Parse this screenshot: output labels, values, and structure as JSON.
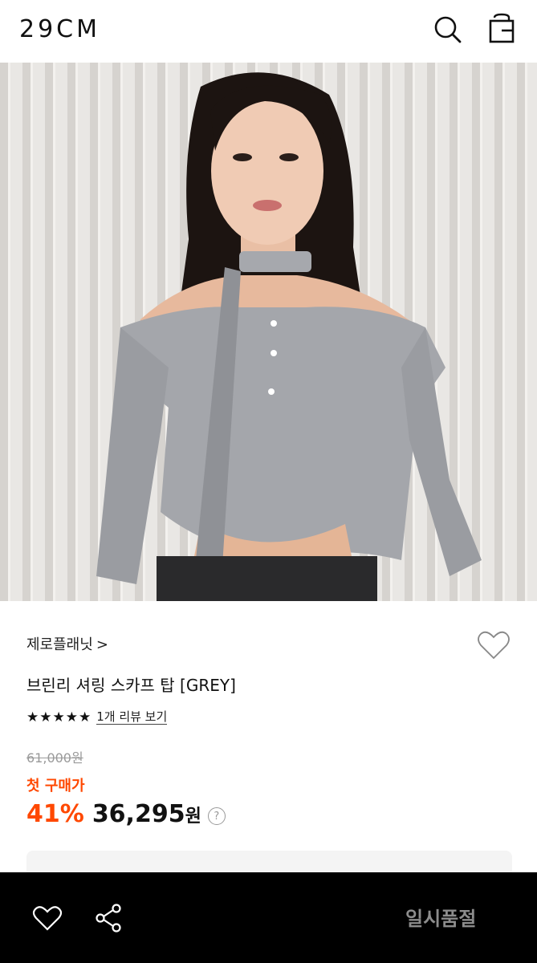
{
  "header": {
    "logo": "29CM",
    "icons": [
      "search-icon",
      "shopping-bag-icon"
    ]
  },
  "gallery": {
    "image": "product-photo-model-grey-knit-top",
    "pager_progress": 0.75
  },
  "product": {
    "brand": "제로플래닛",
    "brand_chevron": ">",
    "name": "브린리 셔링 스카프 탑 [GREY]",
    "rating_stars": "★★★★★",
    "rating_value": 5,
    "review_link": "1개 리뷰 보기",
    "original_price": "61,000원",
    "first_purchase_label": "첫 구매가",
    "discount": "41%",
    "price": "36,295",
    "price_unit": "원",
    "help_icon": "?"
  },
  "bottom_bar": {
    "icons": [
      "heart-icon",
      "share-icon"
    ],
    "status_label": "일시품절"
  },
  "colors": {
    "accent": "#ff4800",
    "bottom_bar_bg": "#000000",
    "soldout_text": "#8c8c8c"
  }
}
